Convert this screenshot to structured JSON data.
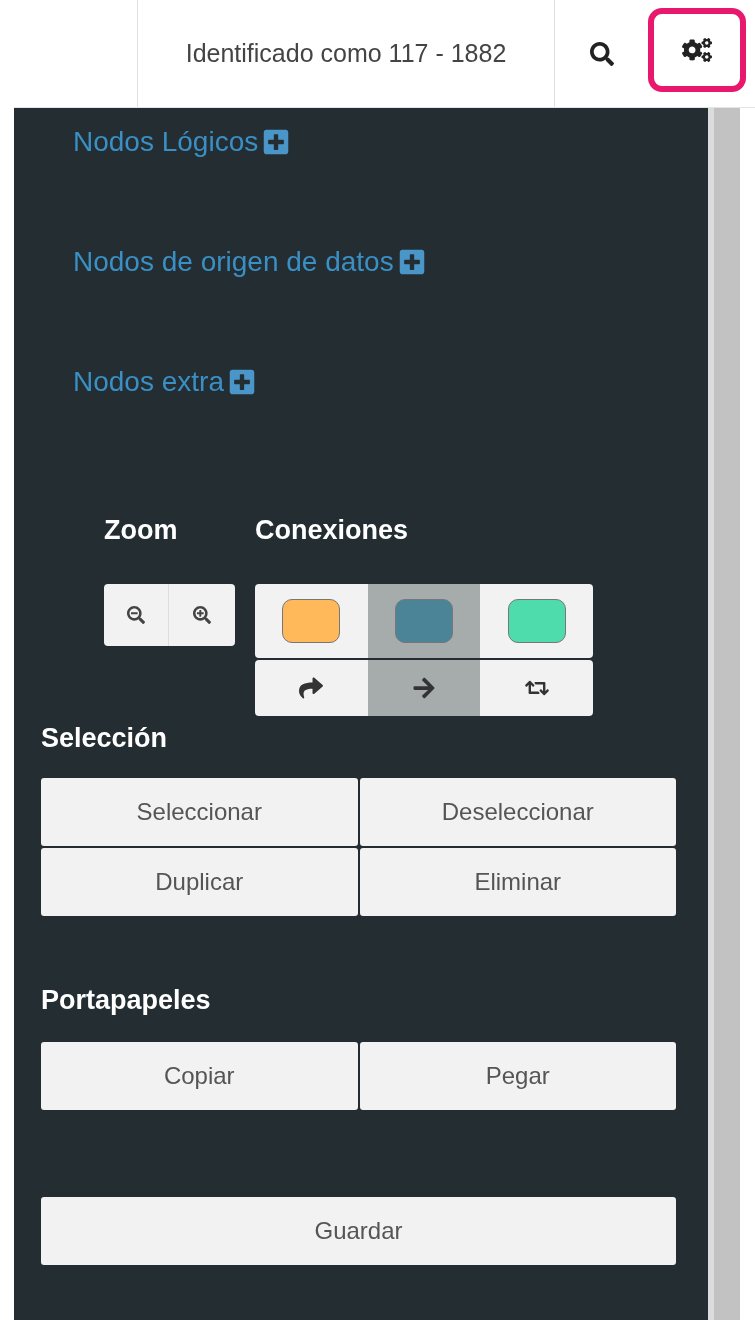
{
  "header": {
    "user_label": "Identificado como 117 - 1882",
    "settings_highlighted": true
  },
  "node_groups": [
    {
      "label": "Nodos Lógicos"
    },
    {
      "label": "Nodos de origen de datos"
    },
    {
      "label": "Nodos extra"
    }
  ],
  "zoom": {
    "title": "Zoom"
  },
  "connections": {
    "title": "Conexiones",
    "colors": [
      {
        "color": "#ffb95a",
        "selected": false
      },
      {
        "color": "#4a8496",
        "selected": true
      },
      {
        "color": "#4fdcac",
        "selected": false
      }
    ],
    "styles": [
      {
        "kind": "curved",
        "selected": false
      },
      {
        "kind": "straight",
        "selected": true
      },
      {
        "kind": "loop",
        "selected": false
      }
    ]
  },
  "selection": {
    "title": "Selección",
    "buttons": [
      "Seleccionar",
      "Deseleccionar",
      "Duplicar",
      "Eliminar"
    ]
  },
  "clipboard": {
    "title": "Portapapeles",
    "buttons": [
      "Copiar",
      "Pegar"
    ]
  },
  "save_button": "Guardar"
}
